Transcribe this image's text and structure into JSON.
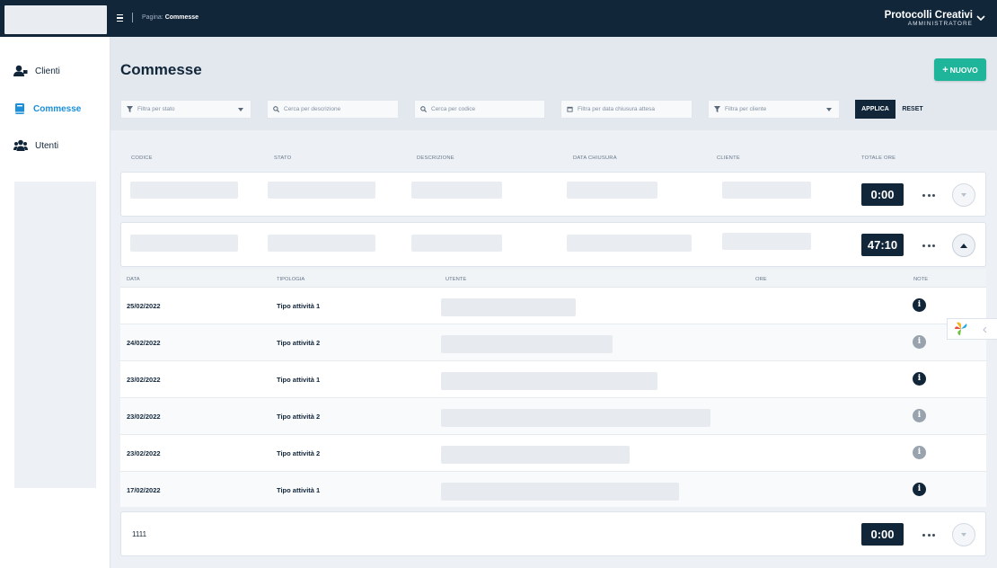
{
  "topbar": {
    "crumb_prefix": "Pagina:",
    "crumb_page": "Commesse",
    "user_name": "Protocolli Creativi",
    "user_role": "AMMINISTRATORE"
  },
  "sidebar": {
    "items": [
      {
        "label": "Clienti",
        "icon": "user-tie-icon",
        "active": false
      },
      {
        "label": "Commesse",
        "icon": "book-icon",
        "active": true
      },
      {
        "label": "Utenti",
        "icon": "users-icon",
        "active": false
      }
    ]
  },
  "page": {
    "title": "Commesse",
    "new_button": "NUOVO"
  },
  "filters": {
    "stato": "Filtra per stato",
    "descrizione": "Cerca per descrizione",
    "codice": "Cerca per codice",
    "data": "Filtra per data chiusura attesa",
    "cliente": "Filtra per cliente",
    "apply": "APPLICA",
    "reset": "RESET"
  },
  "table": {
    "columns": [
      "CODICE",
      "STATO",
      "DESCRIZIONE",
      "DATA CHIUSURA",
      "CLIENTE",
      "TOTALE ORE"
    ],
    "rows": [
      {
        "code": "",
        "hours": "0:00",
        "expanded": false
      },
      {
        "code": "",
        "hours": "47:10",
        "expanded": true
      },
      {
        "code": "1111",
        "hours": "0:00",
        "expanded": false
      }
    ]
  },
  "detail": {
    "columns": [
      "DATA",
      "TIPOLOGIA",
      "UTENTE",
      "ORE",
      "NOTE"
    ],
    "rows": [
      {
        "date": "25/02/2022",
        "type": "Tipo attività 1",
        "note_active": true
      },
      {
        "date": "24/02/2022",
        "type": "Tipo attività 2",
        "note_active": false
      },
      {
        "date": "23/02/2022",
        "type": "Tipo attività 1",
        "note_active": true
      },
      {
        "date": "23/02/2022",
        "type": "Tipo attività 2",
        "note_active": false
      },
      {
        "date": "23/02/2022",
        "type": "Tipo attività 2",
        "note_active": false
      },
      {
        "date": "17/02/2022",
        "type": "Tipo attività 1",
        "note_active": true
      }
    ]
  },
  "icons": {
    "info": "i"
  },
  "colors": {
    "navy": "#12263a",
    "accent_blue": "#1b8fd8",
    "new_button": "#1fb59a"
  }
}
